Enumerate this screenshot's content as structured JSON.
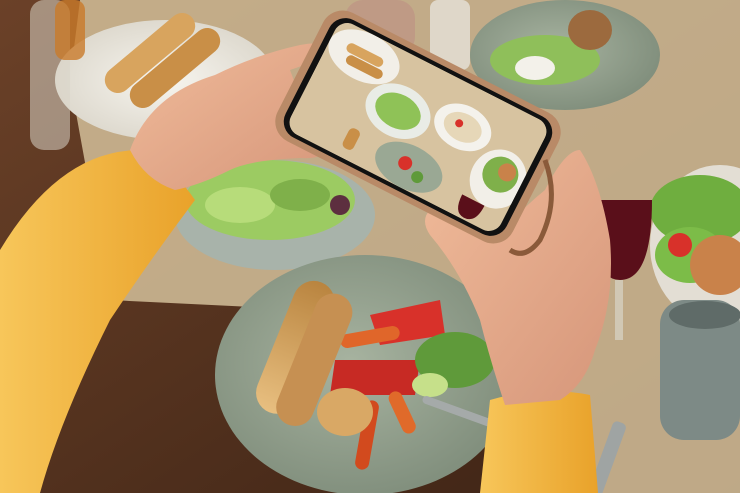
{
  "scene": {
    "description_kind": "photo",
    "palette": {
      "table": "#4a2b1a",
      "table_light": "#6b4128",
      "placemat": "#cdb894",
      "plate_green": "#9aa894",
      "plate_white": "#f2efe8",
      "sleeve": "#f2b43a",
      "skin": "#e7ad8c",
      "phone_case": "#b98a67",
      "lettuce": "#7fb04a",
      "tomato": "#d8312a",
      "pastry": "#d9a865",
      "wine": "#5a0f1a",
      "mug": "#7d8a86"
    }
  }
}
